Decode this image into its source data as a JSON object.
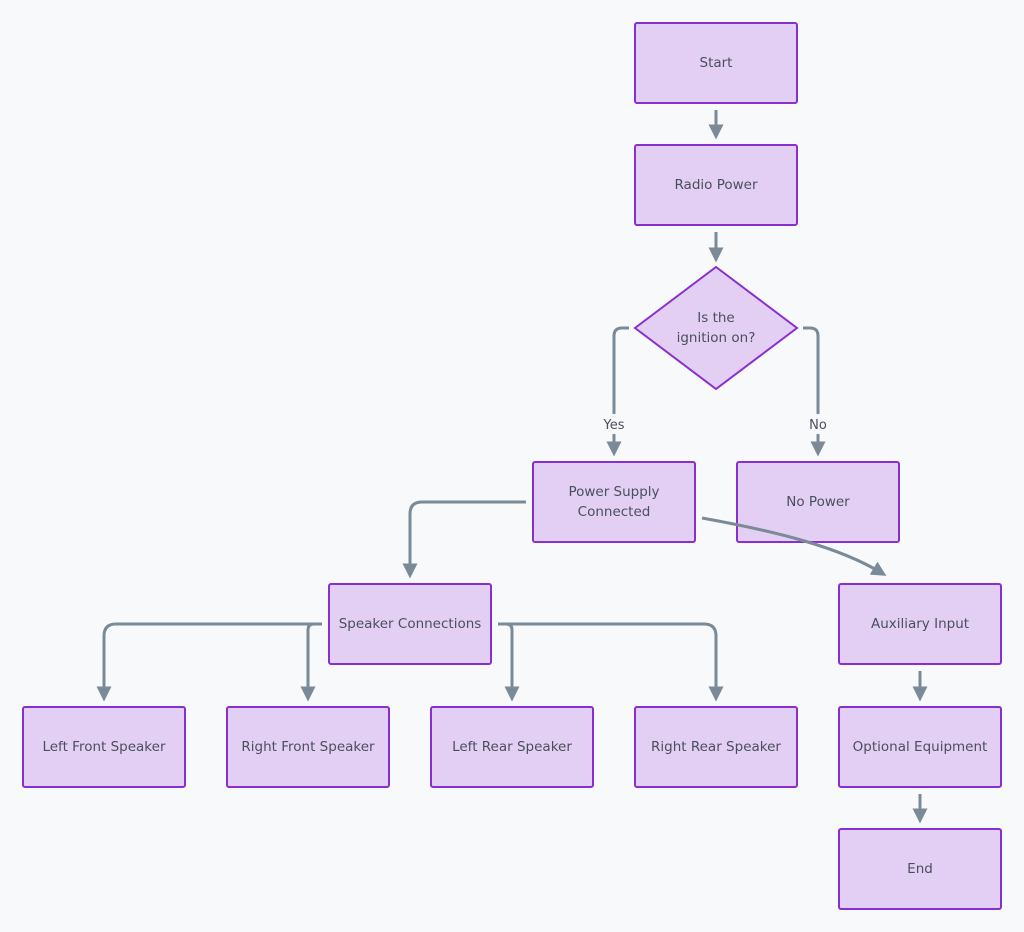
{
  "diagram": {
    "type": "flowchart",
    "colors": {
      "background": "#f8f9fa",
      "node_fill": "#e4cff4",
      "node_border": "#8a2fcf",
      "edge": "#7a8a97",
      "text": "#4a4f5c"
    },
    "nodes": {
      "start": "Start",
      "radio_power": "Radio Power",
      "decision": "Is the\nignition on?",
      "power_supply": "Power Supply\nConnected",
      "no_power": "No Power",
      "speaker_connections": "Speaker Connections",
      "auxiliary_input": "Auxiliary Input",
      "left_front": "Left Front Speaker",
      "right_front": "Right Front Speaker",
      "left_rear": "Left Rear Speaker",
      "right_rear": "Right Rear Speaker",
      "optional_equipment": "Optional Equipment",
      "end": "End"
    },
    "edges": [
      {
        "from": "start",
        "to": "radio_power",
        "label": ""
      },
      {
        "from": "radio_power",
        "to": "decision",
        "label": ""
      },
      {
        "from": "decision",
        "to": "power_supply",
        "label": "Yes"
      },
      {
        "from": "decision",
        "to": "no_power",
        "label": "No"
      },
      {
        "from": "power_supply",
        "to": "speaker_connections",
        "label": ""
      },
      {
        "from": "power_supply",
        "to": "auxiliary_input",
        "label": ""
      },
      {
        "from": "speaker_connections",
        "to": "left_front",
        "label": ""
      },
      {
        "from": "speaker_connections",
        "to": "right_front",
        "label": ""
      },
      {
        "from": "speaker_connections",
        "to": "left_rear",
        "label": ""
      },
      {
        "from": "speaker_connections",
        "to": "right_rear",
        "label": ""
      },
      {
        "from": "auxiliary_input",
        "to": "optional_equipment",
        "label": ""
      },
      {
        "from": "optional_equipment",
        "to": "end",
        "label": ""
      }
    ],
    "edge_labels": {
      "yes": "Yes",
      "no": "No"
    }
  }
}
